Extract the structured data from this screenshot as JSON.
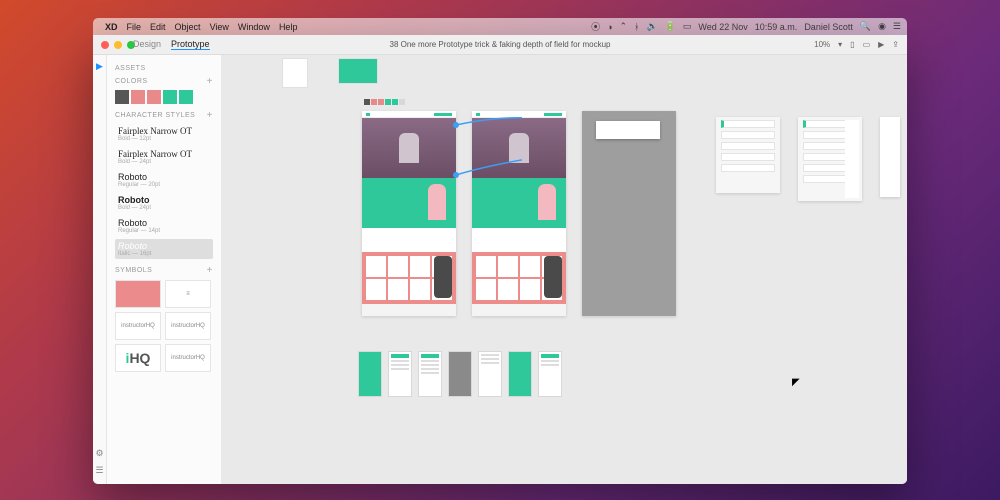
{
  "mac_menu": {
    "app": "XD",
    "items": [
      "File",
      "Edit",
      "Object",
      "View",
      "Window",
      "Help"
    ],
    "date": "Wed 22 Nov",
    "time": "10:59 a.m.",
    "user": "Daniel Scott"
  },
  "titlebar": {
    "modes": {
      "design": "Design",
      "prototype": "Prototype",
      "active": "prototype"
    },
    "document": "38 One more Prototype trick & faking depth of field for mockup",
    "zoom": "10%"
  },
  "assets": {
    "label": "ASSETS",
    "colors_label": "Colors",
    "swatches": [
      "#565656",
      "#e88a8a",
      "#e88a8a",
      "#2fc89a",
      "#2fc89a"
    ],
    "char_label": "Character Styles",
    "char_styles": [
      {
        "name": "Fairplex Narrow OT",
        "sub": "Bold — 12pt"
      },
      {
        "name": "Fairplex Narrow OT",
        "sub": "Bold — 24pt"
      },
      {
        "name": "Roboto",
        "sub": "Regular — 20pt"
      },
      {
        "name": "Roboto",
        "sub": "Bold — 24pt",
        "bold": true
      },
      {
        "name": "Roboto",
        "sub": "Regular — 14pt"
      },
      {
        "name": "Roboto",
        "sub": "Italic — 16pt",
        "selected": true
      }
    ],
    "symbols_label": "Symbols",
    "symbols": [
      "button",
      "menu",
      "instructorHQ",
      "instructorHQ"
    ],
    "logo_text": "iHQ"
  },
  "canvas": {
    "mini_swatches": [
      "#565656",
      "#e88a8a",
      "#e88a8a",
      "#2fc89a",
      "#2fc89a",
      "#d8d8d8"
    ]
  }
}
